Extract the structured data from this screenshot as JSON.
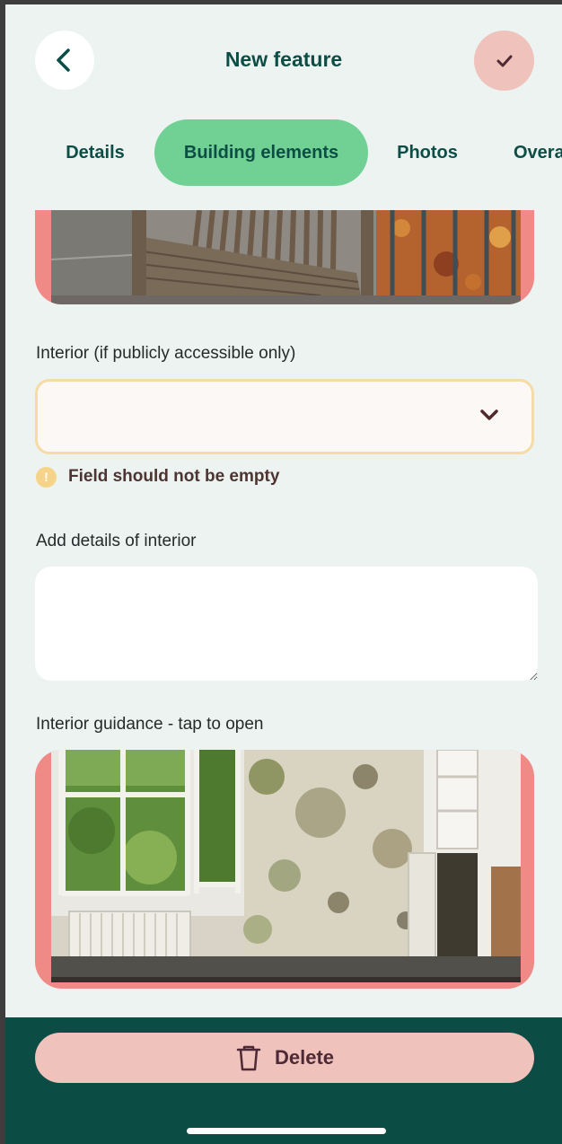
{
  "header": {
    "title": "New feature",
    "back_icon": "chevron-left-icon",
    "confirm_icon": "checkmark-icon"
  },
  "tabs": [
    {
      "label": "Details",
      "active": false
    },
    {
      "label": "Building elements",
      "active": true
    },
    {
      "label": "Photos",
      "active": false
    },
    {
      "label": "Overa",
      "active": false
    }
  ],
  "form": {
    "interior_label": "Interior (if publicly accessible only)",
    "interior_value": "",
    "interior_error": "Field should not be empty",
    "details_label": "Add details of interior",
    "details_value": "",
    "guidance_label": "Interior guidance - tap to open"
  },
  "images": {
    "top": "bench-and-railings-photo",
    "guidance": "damp-interior-room-photo"
  },
  "footer": {
    "delete_label": "Delete",
    "delete_icon": "trash-icon"
  },
  "colors": {
    "primary_dark": "#0b4c45",
    "tab_active": "#71d093",
    "accent_pink": "#efc2bc",
    "image_border": "#f08a86",
    "warning": "#f5d48a",
    "background": "#edf3f1"
  }
}
